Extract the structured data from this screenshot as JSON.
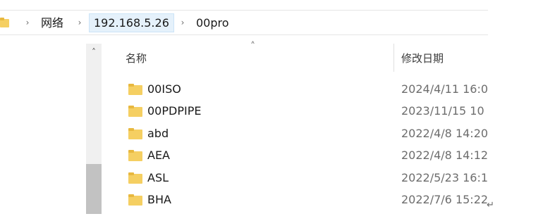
{
  "breadcrumb": {
    "items": [
      {
        "label": "网络"
      },
      {
        "label": "192.168.5.26"
      },
      {
        "label": "00pro"
      }
    ]
  },
  "columns": {
    "name": "名称",
    "date_modified": "修改日期"
  },
  "files": [
    {
      "name": "00ISO",
      "date": "2024/4/11 16:0"
    },
    {
      "name": "00PDPIPE",
      "date": "2023/11/15 10"
    },
    {
      "name": "abd",
      "date": "2022/4/8 14:20"
    },
    {
      "name": "AEA",
      "date": "2022/4/8 14:12"
    },
    {
      "name": "ASL",
      "date": "2022/5/23 16:1"
    },
    {
      "name": "BHA",
      "date": "2022/7/6 15:22"
    }
  ],
  "icons": {
    "folder": "folder-icon",
    "separator": "chevron-right-icon",
    "scroll_up": "chevron-up-icon",
    "sort": "sort-ascending-icon"
  },
  "colors": {
    "folder_fill": "#f5cf62",
    "folder_tab": "#e8b83f",
    "active_crumb_bg": "#e5f1fb",
    "scroll_thumb": "#c2c2c2"
  }
}
